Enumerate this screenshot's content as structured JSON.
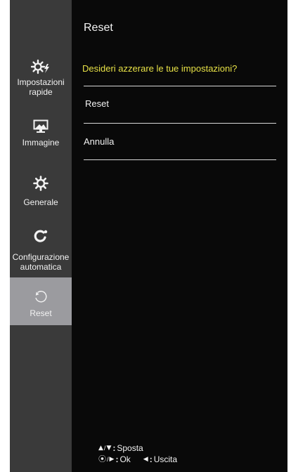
{
  "sidebar": {
    "items": [
      {
        "label_line1": "Impostazioni",
        "label_line2": "rapide",
        "icon": "gear-bolt-icon",
        "active": false
      },
      {
        "label_line1": "Immagine",
        "label_line2": "",
        "icon": "picture-icon",
        "active": false
      },
      {
        "label_line1": "Generale",
        "label_line2": "",
        "icon": "gear-icon",
        "active": false
      },
      {
        "label_line1": "Configurazione",
        "label_line2": "automatica",
        "icon": "auto-config-icon",
        "active": false
      },
      {
        "label_line1": "Reset",
        "label_line2": "",
        "icon": "reset-icon",
        "active": true
      }
    ]
  },
  "main": {
    "title": "Reset",
    "question": "Desideri azzerare le tue impostazioni?",
    "options": [
      {
        "label": "Reset"
      },
      {
        "label": "Annulla"
      }
    ]
  },
  "footer": {
    "move_glyphs": [
      "▲",
      "/",
      "▼"
    ],
    "move_label": "Sposta",
    "ok_glyphs": [
      "⦿",
      "/",
      "▶"
    ],
    "ok_label": "Ok",
    "exit_glyph": "◀",
    "exit_label": "Uscita"
  },
  "colors": {
    "background": "#090909",
    "sidebar": "#3a3a3a",
    "sidebar_active": "#9b9b9f",
    "accent_text": "#e7e146",
    "text": "#f2f2f2"
  }
}
